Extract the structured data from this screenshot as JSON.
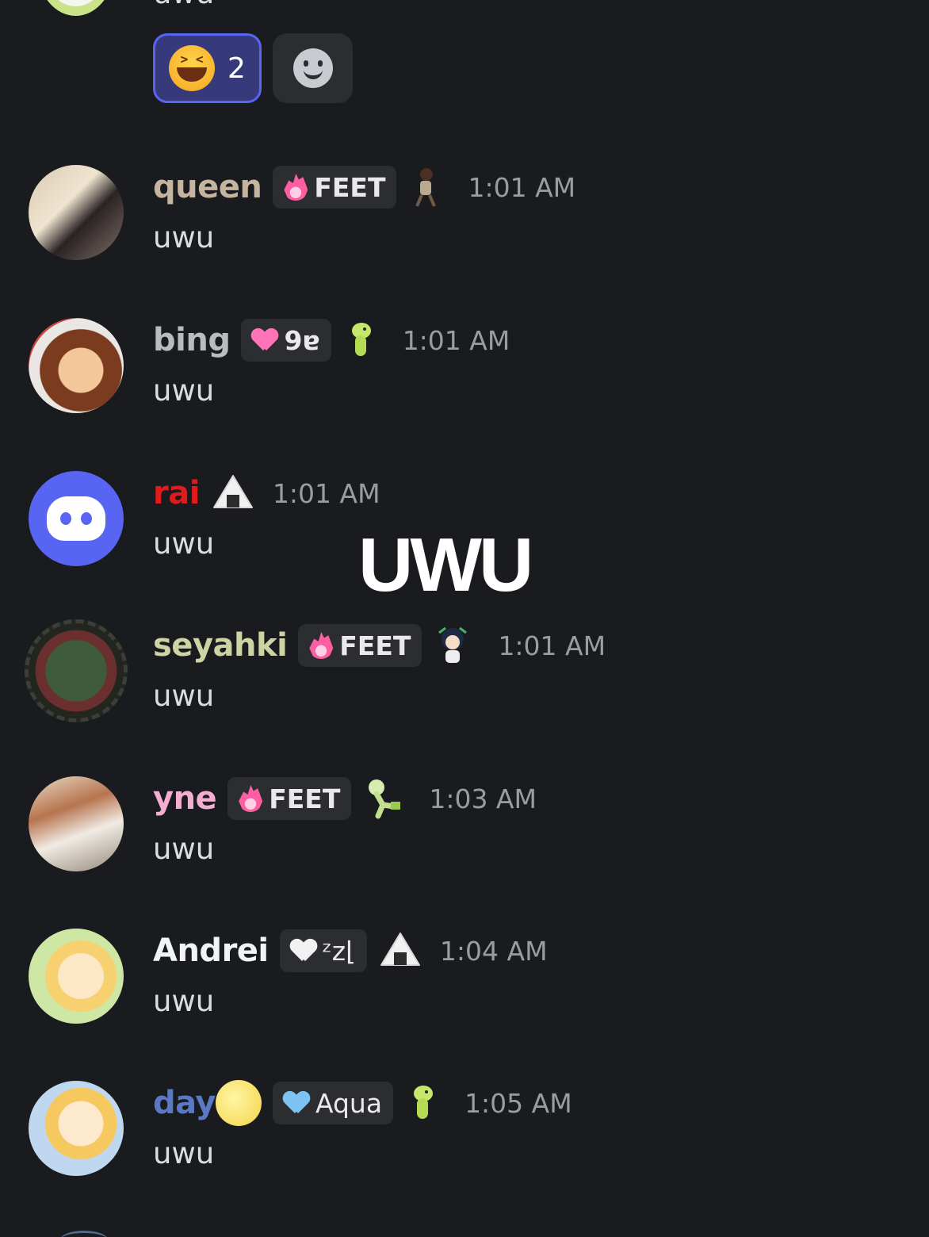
{
  "top_message": {
    "text": "uwu"
  },
  "reactions": [
    {
      "emoji": "laughing-emoji",
      "count": "2",
      "active": true
    },
    {
      "emoji": "add-reaction-icon"
    }
  ],
  "messages": [
    {
      "username": "queen",
      "name_color": "#c5b59f",
      "tag": {
        "icon": "flame-icon",
        "label": "FEET"
      },
      "sticker": "figure-sticker",
      "time": "1:01 AM",
      "text": "uwu"
    },
    {
      "username": "bing",
      "name_color": "#b9bbc0",
      "tag": {
        "icon": "pink-heart-icon",
        "label": "9ɐ"
      },
      "sticker": "green-dino-sticker",
      "time": "1:01 AM",
      "text": "uwu"
    },
    {
      "username": "rai",
      "name_color": "#e21a1a",
      "tag": null,
      "sticker": "onigiri-sticker",
      "time": "1:01 AM",
      "text": "uwu"
    },
    {
      "username": "seyahki",
      "name_color": "#cfd2a2",
      "tag": {
        "icon": "flame-icon",
        "label": "FEET"
      },
      "sticker": "chibi-sticker",
      "time": "1:01 AM",
      "text": "uwu"
    },
    {
      "username": "yne",
      "name_color": "#f3aed0",
      "tag": {
        "icon": "flame-icon",
        "label": "FEET"
      },
      "sticker": "running-dino-sticker",
      "time": "1:03 AM",
      "text": "uwu"
    },
    {
      "username": "Andrei",
      "name_color": "#f2f3f5",
      "tag": {
        "icon": "white-heart-icon",
        "label": "ᶻz⌊"
      },
      "sticker": "onigiri-sticker",
      "time": "1:04 AM",
      "text": "uwu"
    },
    {
      "username": "day",
      "name_color": "#5a78c4",
      "name_emoji": "moon-face-emoji",
      "tag": {
        "icon": "blue-heart-icon",
        "label": "Aqua"
      },
      "sticker": "green-dino-sticker",
      "time": "1:05 AM",
      "text": "uwu"
    }
  ],
  "overlay": {
    "text": "UWU"
  }
}
